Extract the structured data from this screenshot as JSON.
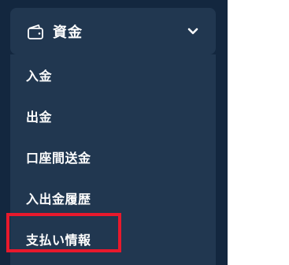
{
  "menu": {
    "header": {
      "label": "資金",
      "icon": "wallet-icon",
      "expand_icon": "chevron-down-icon"
    },
    "items": [
      {
        "label": "入金"
      },
      {
        "label": "出金"
      },
      {
        "label": "口座間送金"
      },
      {
        "label": "入出金履歴"
      },
      {
        "label": "支払い情報"
      }
    ]
  },
  "colors": {
    "sidebar_bg": "#13273f",
    "panel_bg": "#213750",
    "text": "#ffffff",
    "highlight": "#e8192c"
  }
}
